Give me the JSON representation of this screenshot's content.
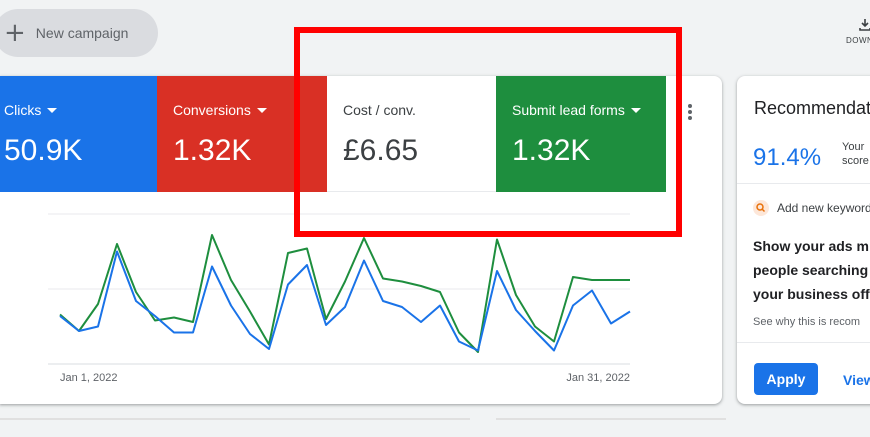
{
  "toolbar": {
    "new_campaign_label": "New campaign",
    "download_label": "DOWN"
  },
  "metrics": [
    {
      "label": "Clicks",
      "value": "50.9K",
      "color": "#1a73e8"
    },
    {
      "label": "Conversions",
      "value": "1.32K",
      "color": "#d93025"
    },
    {
      "label": "Cost / conv.",
      "value": "£6.65",
      "color": "#ffffff"
    },
    {
      "label": "Submit lead forms",
      "value": "1.32K",
      "color": "#1e8e3e"
    }
  ],
  "chart_data": {
    "type": "line",
    "x_labels": [
      "Jan 1, 2022",
      "Jan 31, 2022"
    ],
    "ylim": [
      0,
      10
    ],
    "grid": true,
    "series": [
      {
        "color": "#1a73e8",
        "values": [
          3.2,
          2.2,
          2.5,
          7.5,
          4.2,
          3.2,
          2.1,
          2.1,
          6.5,
          3.9,
          2.0,
          1.0,
          5.3,
          6.6,
          2.6,
          3.8,
          6.9,
          4.2,
          3.8,
          2.8,
          3.9,
          1.5,
          0.9,
          6.2,
          3.6,
          2.2,
          0.9,
          3.9,
          4.9,
          2.7,
          3.5
        ]
      },
      {
        "color": "#1e8e3e",
        "values": [
          3.3,
          2.2,
          4.0,
          8.0,
          4.8,
          2.9,
          3.1,
          2.8,
          8.6,
          5.6,
          3.5,
          1.3,
          7.4,
          7.7,
          3.0,
          5.5,
          8.4,
          5.7,
          5.5,
          5.2,
          4.8,
          2.1,
          0.8,
          8.3,
          4.6,
          2.5,
          1.5,
          5.8,
          5.6,
          5.6,
          5.6
        ]
      }
    ]
  },
  "recommendations": {
    "title": "Recommendations",
    "score": "91.4%",
    "score_line1": "Your",
    "score_line2": "score",
    "keyword_label": "Add new keywords",
    "desc_line1": "Show your ads m",
    "desc_line2": "people searching",
    "desc_line3": "your business off",
    "why_link": "See why this is recom",
    "apply_label": "Apply",
    "view_label": "View"
  }
}
